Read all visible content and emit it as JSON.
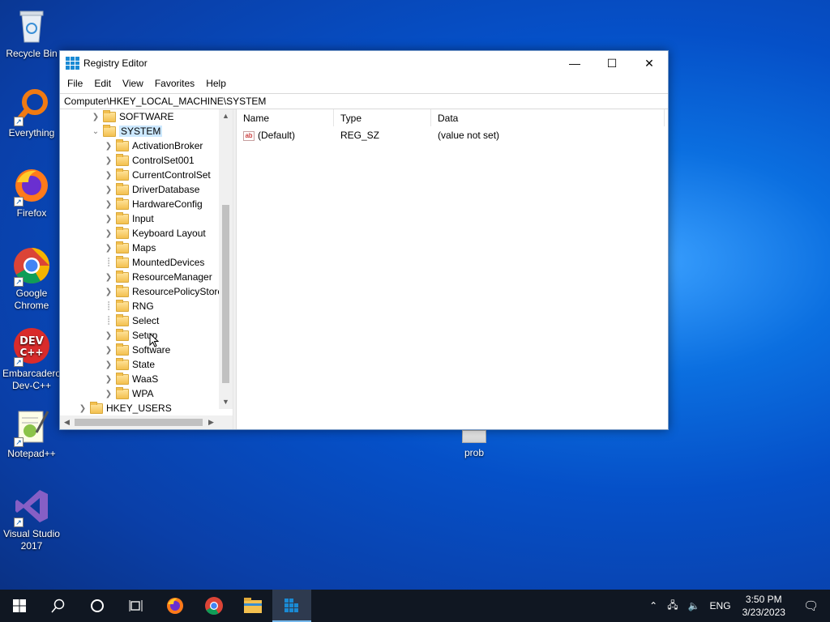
{
  "desktop": {
    "icons": [
      {
        "label": "Recycle Bin",
        "icon": "recycle-bin-icon"
      },
      {
        "label": "Everything",
        "icon": "everything-icon"
      },
      {
        "label": "Firefox",
        "icon": "firefox-icon"
      },
      {
        "label": "Google Chrome",
        "icon": "chrome-icon"
      },
      {
        "label": "Embarcadero Dev-C++",
        "icon": "devcpp-icon"
      },
      {
        "label": "Notepad++",
        "icon": "notepadpp-icon"
      },
      {
        "label": "Visual Studio 2017",
        "icon": "visual-studio-icon"
      }
    ],
    "file_icon": {
      "label": "prob"
    }
  },
  "window": {
    "title": "Registry Editor",
    "controls": {
      "minimize": "—",
      "maximize": "☐",
      "close": "✕"
    },
    "menu": [
      "File",
      "Edit",
      "View",
      "Favorites",
      "Help"
    ],
    "address": "Computer\\HKEY_LOCAL_MACHINE\\SYSTEM",
    "tree": {
      "software": "SOFTWARE",
      "system": "SYSTEM",
      "children": [
        "ActivationBroker",
        "ControlSet001",
        "CurrentControlSet",
        "DriverDatabase",
        "HardwareConfig",
        "Input",
        "Keyboard Layout",
        "Maps",
        "MountedDevices",
        "ResourceManager",
        "ResourcePolicyStore",
        "RNG",
        "Select",
        "Setup",
        "Software",
        "State",
        "WaaS",
        "WPA"
      ],
      "hkey_users": "HKEY_USERS"
    },
    "list": {
      "columns": [
        "Name",
        "Type",
        "Data"
      ],
      "rows": [
        {
          "name": "(Default)",
          "type": "REG_SZ",
          "data": "(value not set)"
        }
      ]
    }
  },
  "taskbar": {
    "tray": {
      "lang": "ENG",
      "time": "3:50 PM",
      "date": "3/23/2023"
    }
  }
}
